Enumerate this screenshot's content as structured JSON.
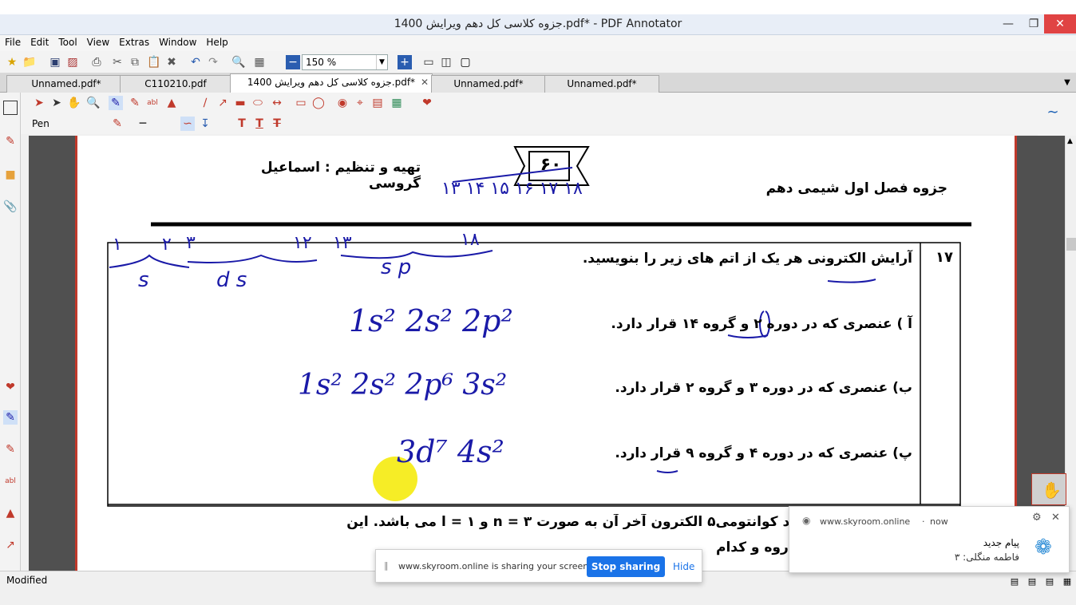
{
  "window": {
    "title": "جزوه کلاسی کل دهم ویرایش 1400.pdf* - PDF Annotator"
  },
  "menu": [
    "File",
    "Edit",
    "Tool",
    "View",
    "Extras",
    "Window",
    "Help"
  ],
  "zoom": "150 %",
  "tabs": [
    {
      "label": "Unnamed.pdf*"
    },
    {
      "label": "C110210.pdf"
    },
    {
      "label": "جزوه کلاسی کل دهم ویرایش 1400.pdf*",
      "active": true
    },
    {
      "label": "Unnamed.pdf*"
    },
    {
      "label": "Unnamed.pdf*"
    }
  ],
  "tool": {
    "label": "Pen"
  },
  "document": {
    "author": "تهیه و تنظیم : اسماعیل گروسی",
    "page_number": "۶۰",
    "heading": "جزوه فصل اول شیمی دهم",
    "question_number": "۱۷",
    "question": "آرایش الکترونی هر یک از اتم های زیر را بنویسید.",
    "items": [
      "آ ) عنصری که در دوره ۲ و گروه ۱۴ قرار دارد.",
      "ب) عنصری که در دوره ۳ و گروه ۲ قرار دارد.",
      "پ) عنصری که در دوره ۴ و گروه ۹ قرار دارد."
    ],
    "next_question": "اتمی را بنویسید که اعداد کوانتومی۵ الکترون آخر آن به صورت n = ۳ و l = ۱ می باشد. این",
    "next_question_2": "روه و کدام"
  },
  "annotations": {
    "answer_a": "1s² 2s² 2p²",
    "answer_b": "1s² 2s² 2p⁶ 3s²",
    "answer_c": "3d⁷ 4s²",
    "block_labels": [
      "s",
      "d s",
      "s p"
    ],
    "group_numbers": [
      "۱",
      "۲",
      "۳",
      "۱۲",
      "۱۳",
      "۱۸"
    ],
    "period_numbers": "۱۳ ۱۴ ۱۵ ۱۶ ۱۷ ۱۸"
  },
  "status": {
    "text": "Modified"
  },
  "notification": {
    "source": "www.skyroom.online",
    "time": "now",
    "title": "پیام جدید",
    "body": "فاطمه منگلی: ۳"
  },
  "sharing": {
    "message": "www.skyroom.online is sharing your screen.",
    "stop_label": "Stop sharing",
    "hide_label": "Hide"
  },
  "colors": {
    "ink": "#1a1aa8",
    "accent": "#1a73e8",
    "border_red": "#c0392b",
    "highlight": "#f5ea00"
  }
}
